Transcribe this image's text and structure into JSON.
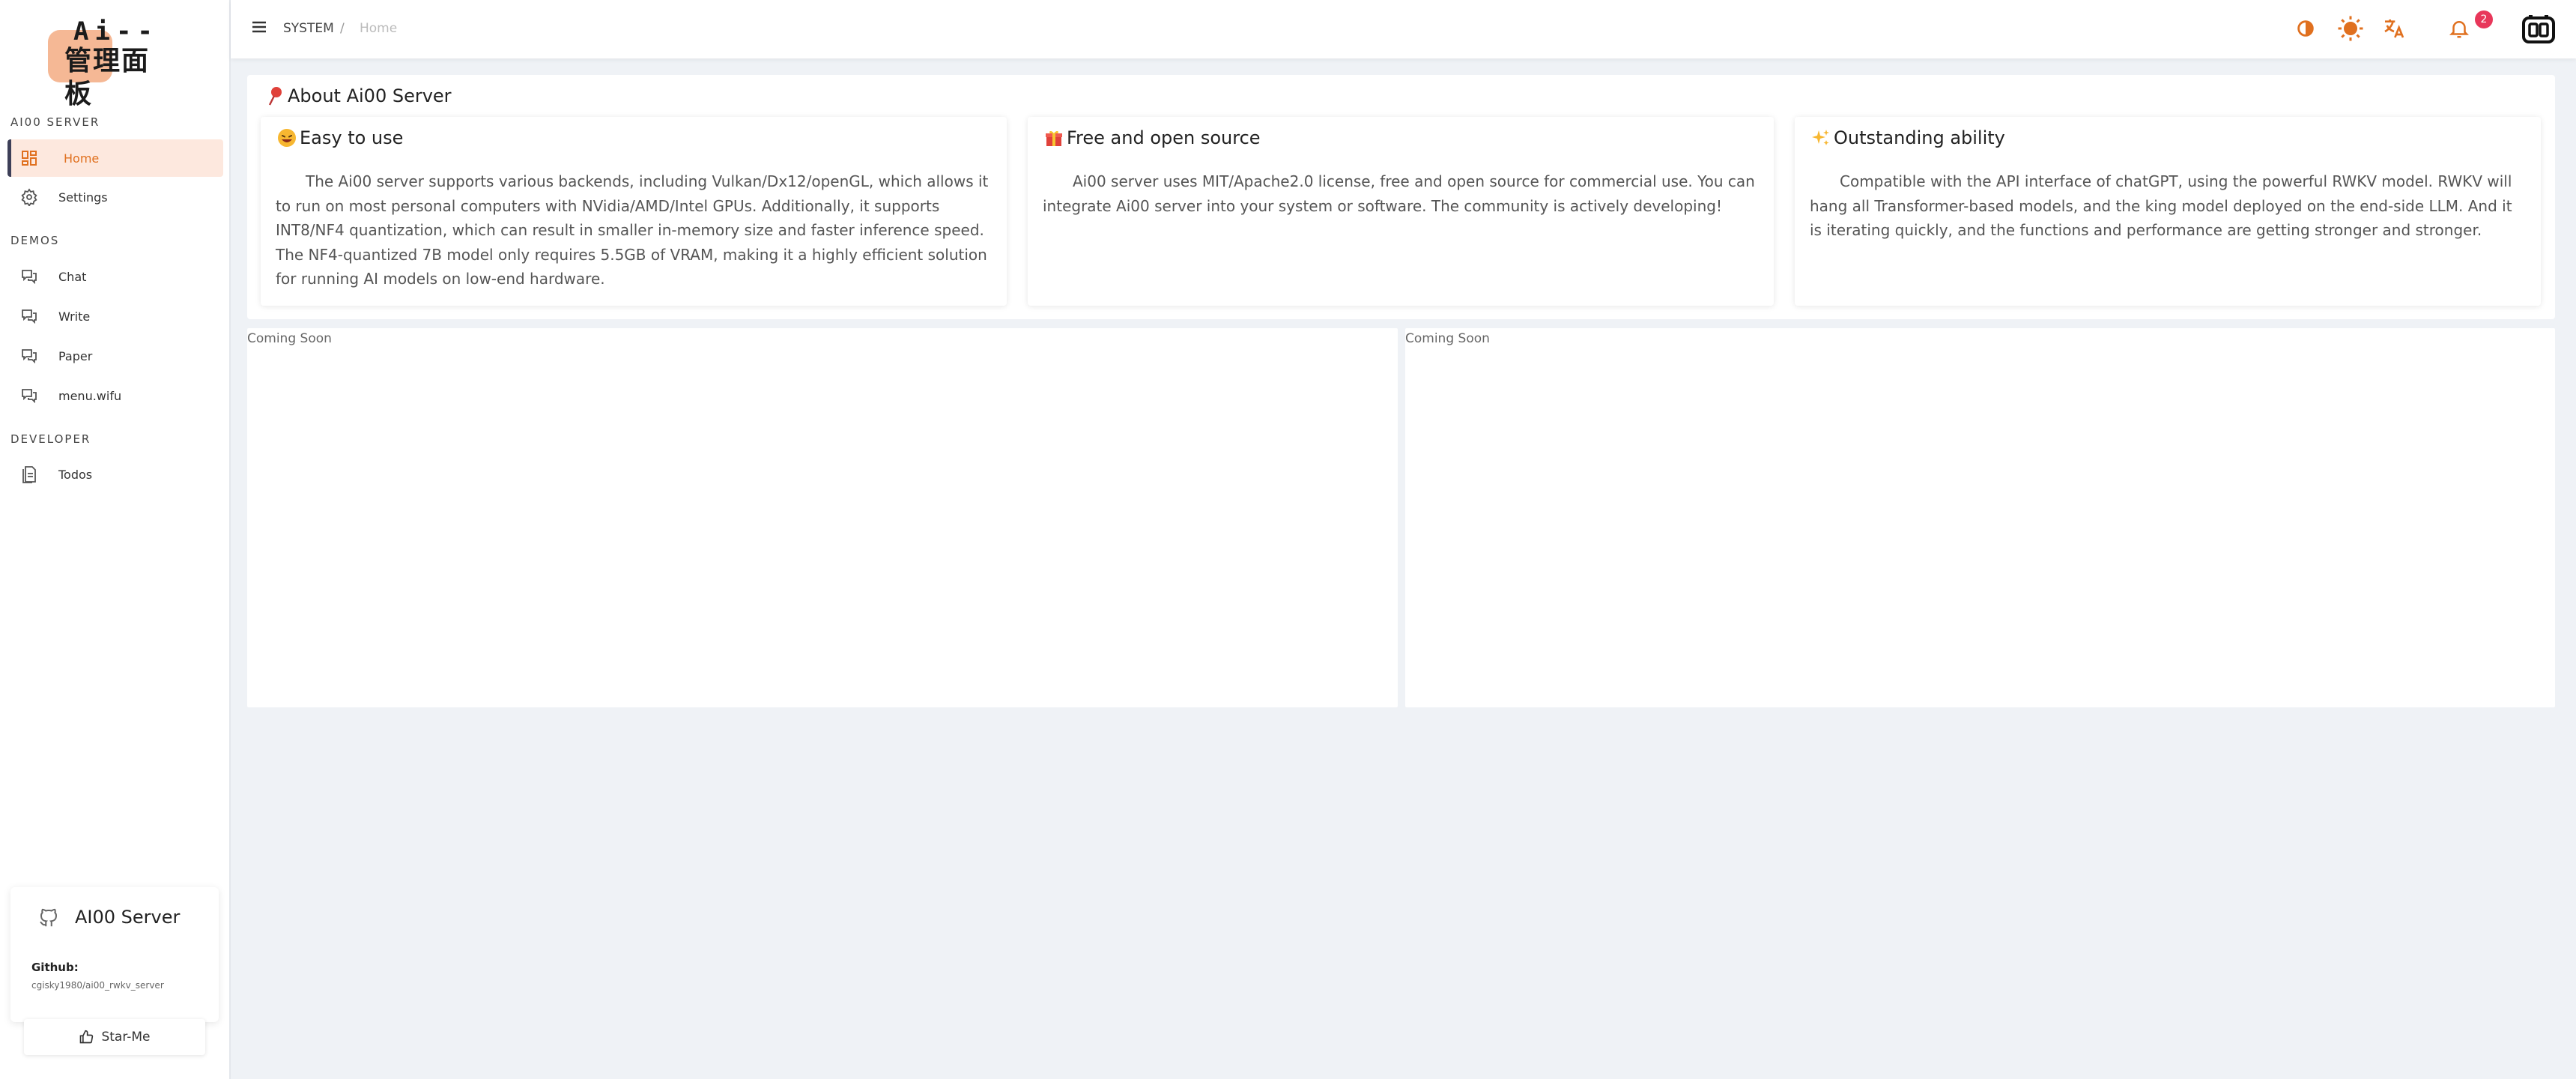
{
  "logo": {
    "line1": "Ai--",
    "line2": "管理面板"
  },
  "sidebar": {
    "sections": [
      {
        "label": "AI00 SERVER"
      },
      {
        "label": "DEMOS"
      },
      {
        "label": "DEVELOPER"
      }
    ],
    "items": [
      {
        "label": "Home",
        "icon": "dashboard-icon",
        "active": true
      },
      {
        "label": "Settings",
        "icon": "gear-icon"
      },
      {
        "label": "Chat",
        "icon": "chat-icon"
      },
      {
        "label": "Write",
        "icon": "chat-icon"
      },
      {
        "label": "Paper",
        "icon": "chat-icon"
      },
      {
        "label": "menu.wifu",
        "icon": "chat-icon"
      },
      {
        "label": "Todos",
        "icon": "document-icon"
      }
    ],
    "github_card": {
      "title": "AI00 Server",
      "label": "Github:",
      "repo": "cgisky1980/ai00_rwkv_server",
      "star_label": "Star-Me"
    }
  },
  "topbar": {
    "breadcrumb": {
      "system": "SYSTEM",
      "separator": "/",
      "current": "Home"
    },
    "notification_count": "2",
    "icons": [
      "contrast-icon",
      "sun-icon",
      "translate-icon",
      "bell-icon",
      "ai00-logo-icon"
    ]
  },
  "about": {
    "title": "About Ai00 Server",
    "cards": [
      {
        "title": "Easy to use",
        "emoji": "grinning-face",
        "body": "The Ai00 server supports various backends, including Vulkan/Dx12/openGL, which allows it to run on most personal computers with NVidia/AMD/Intel GPUs. Additionally, it supports INT8/NF4 quantization, which can result in smaller in-memory size and faster inference speed. The NF4-quantized 7B model only requires 5.5GB of VRAM, making it a highly efficient solution for running AI models on low-end hardware."
      },
      {
        "title": "Free and open source",
        "emoji": "gift",
        "body": "Ai00 server uses MIT/Apache2.0 license, free and open source for commercial use. You can integrate Ai00 server into your system or software. The community is actively developing!"
      },
      {
        "title": "Outstanding ability",
        "emoji": "sparkles",
        "body": "Compatible with the API interface of chatGPT, using the powerful RWKV model. RWKV will hang all Transformer-based models, and the king model deployed on the end-side LLM. And it is iterating quickly, and the functions and performance are getting stronger and stronger."
      }
    ]
  },
  "panels": [
    {
      "label": "Coming Soon"
    },
    {
      "label": "Coming Soon"
    }
  ],
  "colors": {
    "accent": "#e0701f",
    "active_bg": "#fde8de",
    "badge": "#e8375a",
    "page_bg": "#eff2f6"
  }
}
